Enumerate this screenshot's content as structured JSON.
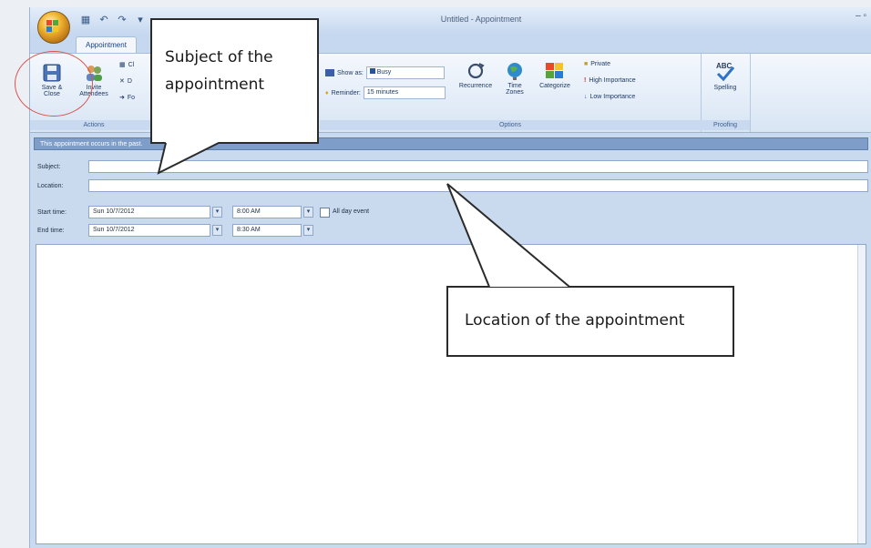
{
  "window": {
    "title": "Untitled - Appointment",
    "qat": [
      "save-icon",
      "undo-icon",
      "redo-icon",
      "dropdown-icon"
    ],
    "controls": "– ▫"
  },
  "tabs": [
    {
      "label": "Appointment",
      "active": true
    },
    {
      "label": "...",
      "active": false
    },
    {
      "label": "...",
      "active": false
    },
    {
      "label": "...",
      "active": false
    },
    {
      "label": "...",
      "active": false
    }
  ],
  "ribbon": {
    "actions": {
      "save_close_label": "Save & Close",
      "invite_label": "Invite Attendees",
      "small_a": "Cl",
      "small_b": "D",
      "small_c": "Fo",
      "group_label": "Actions"
    },
    "options": {
      "show_as_label": "Show as:",
      "show_as_value": "Busy",
      "reminder_label": "Reminder:",
      "reminder_value": "15 minutes",
      "recurrence_label": "Recurrence",
      "time_zones_label": "Time Zones",
      "categorize_label": "Categorize",
      "private_label": "Private",
      "high_importance_label": "High Importance",
      "low_importance_label": "Low Importance",
      "group_label": "Options"
    },
    "proofing": {
      "spelling_label": "Spelling",
      "group_label": "Proofing"
    }
  },
  "infobar": "This appointment occurs in the past.",
  "form": {
    "subject_label": "Subject:",
    "subject_value": "",
    "location_label": "Location:",
    "location_value": "",
    "start_label": "Start time:",
    "start_date": "Sun 10/7/2012",
    "start_time": "8:00 AM",
    "end_label": "End time:",
    "end_date": "Sun 10/7/2012",
    "end_time": "8:30 AM",
    "all_day_label": "All day event",
    "all_day_checked": false
  },
  "callouts": {
    "subject": "Subject of the appointment",
    "location": "Location of the appointment"
  },
  "colors": {
    "ribbon": "#dbe7f5",
    "accent": "#15428b",
    "highlight_circle": "#d9534f"
  }
}
